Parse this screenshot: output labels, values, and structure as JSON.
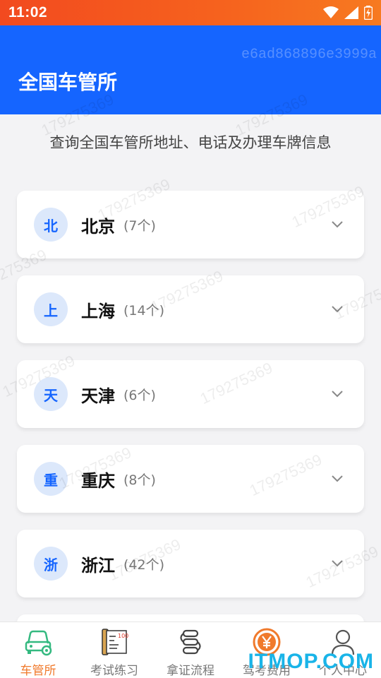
{
  "status_bar": {
    "time": "11:02"
  },
  "header": {
    "title": "全国车管所",
    "watermark": "e6ad868896e3999a"
  },
  "subtitle": "查询全国车管所地址、电话及办理车牌信息",
  "cities": [
    {
      "badge": "北",
      "name": "北京",
      "count": "(7个)"
    },
    {
      "badge": "上",
      "name": "上海",
      "count": "(14个)"
    },
    {
      "badge": "天",
      "name": "天津",
      "count": "(6个)"
    },
    {
      "badge": "重",
      "name": "重庆",
      "count": "(8个)"
    },
    {
      "badge": "浙",
      "name": "浙江",
      "count": "(42个)"
    }
  ],
  "watermark_text": "179275369",
  "tabs": [
    {
      "label": "车管所",
      "icon": "car-gear-icon",
      "active": true
    },
    {
      "label": "考试练习",
      "icon": "exam-paper-icon",
      "active": false
    },
    {
      "label": "拿证流程",
      "icon": "process-flow-icon",
      "active": false
    },
    {
      "label": "驾考费用",
      "icon": "yuan-coin-icon",
      "active": false
    },
    {
      "label": "个人中心",
      "icon": "user-icon",
      "active": false
    }
  ],
  "site_logo": "ITMOP.COM",
  "colors": {
    "primary": "#1565ff",
    "status_bar": "#f6631e",
    "active_tab": "#f07a2c",
    "badge_bg": "#dce8fb"
  }
}
